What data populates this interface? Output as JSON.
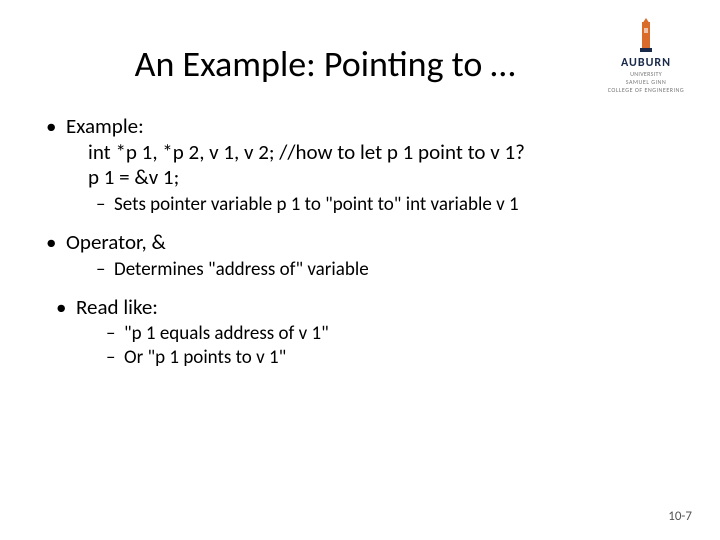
{
  "logo": {
    "word": "AUBURN",
    "sub1": "UNIVERSITY",
    "sub2": "SAMUEL GINN",
    "sub3": "COLLEGE OF ENGINEERING"
  },
  "title": "An Example: Pointing to …",
  "b1": {
    "example_label": "Example:",
    "code_line1": "int *p 1, *p 2, v 1, v 2; //how to let p 1 point to v 1?",
    "code_line2": "p 1 = &v 1;",
    "sub_example": "Sets pointer variable p 1 to \"point to\" int variable v 1",
    "operator_label": "Operator, &",
    "sub_operator": "Determines \"address of\" variable",
    "read_label": "Read like:",
    "sub_read1": "\"p 1 equals address of v 1\"",
    "sub_read2": "Or \"p 1 points to v 1\""
  },
  "footer": "10-7"
}
